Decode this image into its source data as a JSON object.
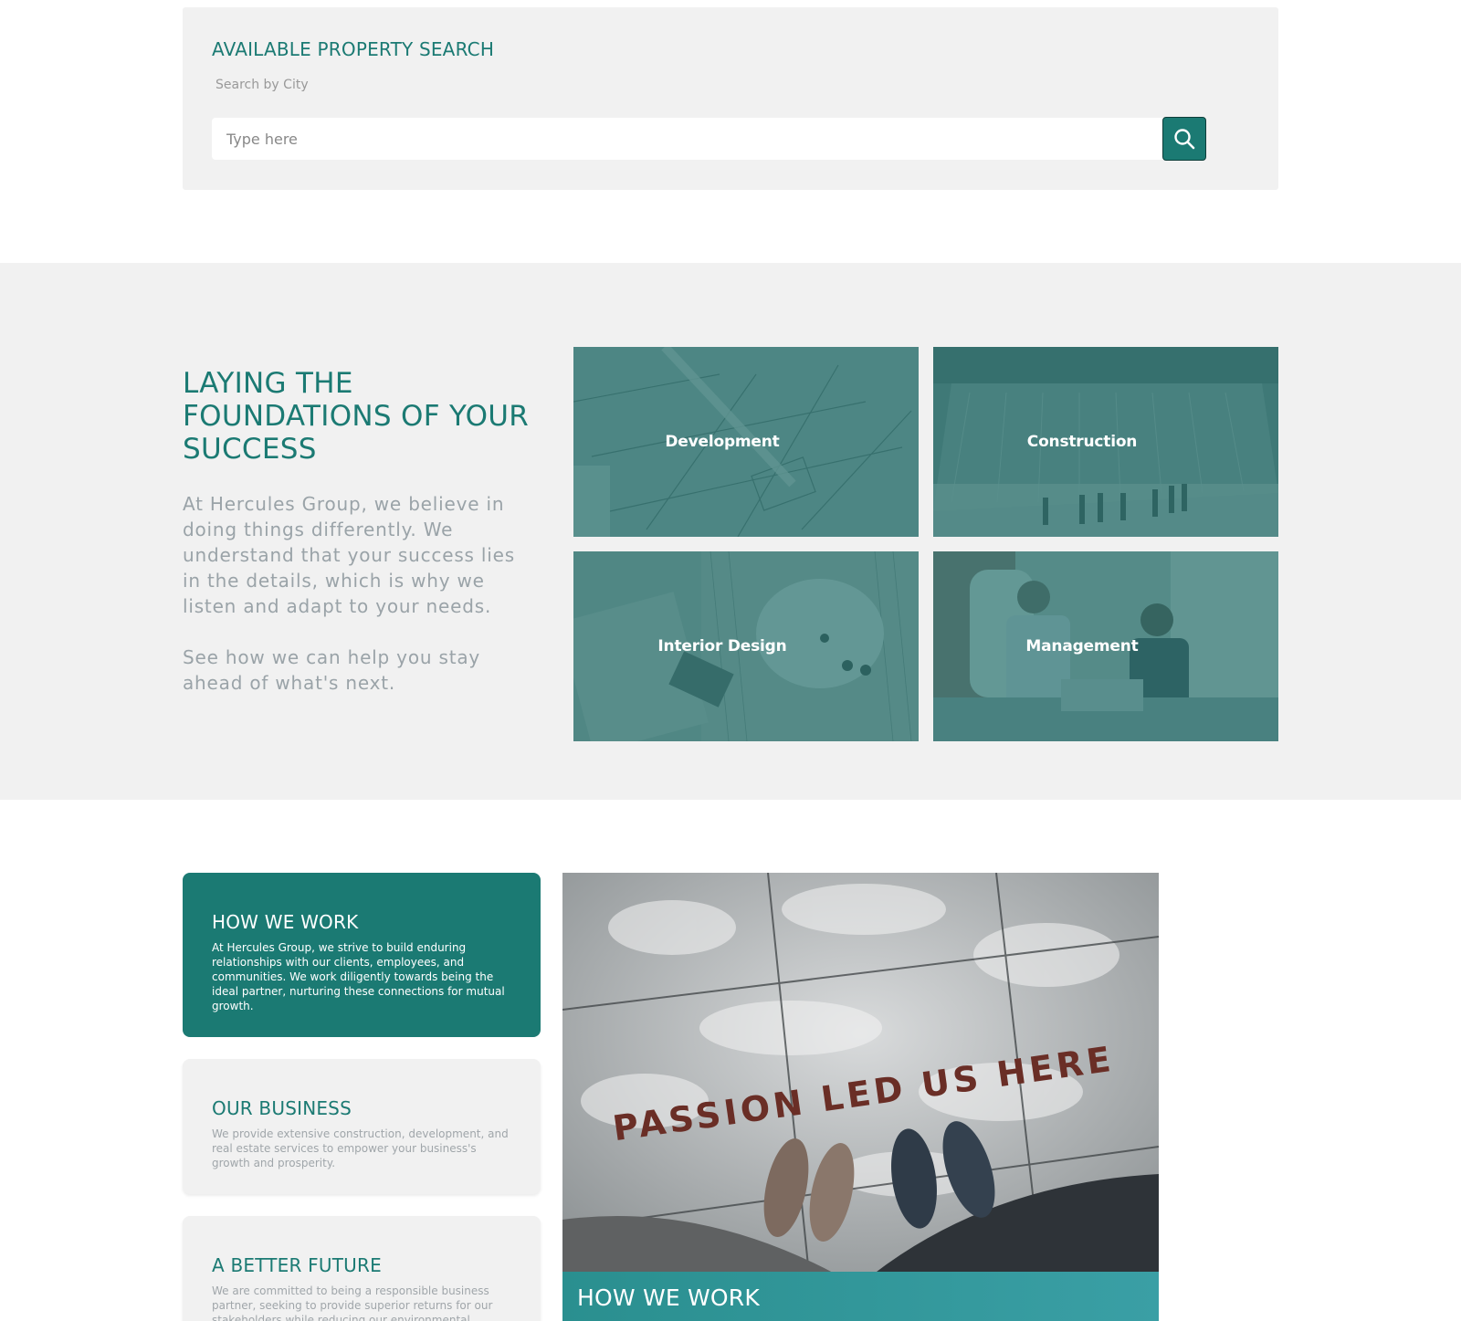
{
  "search": {
    "title": "AVAILABLE PROPERTY SEARCH",
    "label": "Search by City",
    "placeholder": "Type here",
    "button_icon": "search-icon"
  },
  "foundations": {
    "heading": "LAYING THE FOUNDATIONS OF YOUR SUCCESS",
    "paragraph1": "At Hercules Group, we believe in doing things differently. We understand that your success lies in the details, which is why we listen and adapt to your needs.",
    "paragraph2": "See how we can help you stay ahead of what's next.",
    "tiles": [
      {
        "label": "Development"
      },
      {
        "label": "Construction"
      },
      {
        "label": "Interior Design"
      },
      {
        "label": "Management"
      }
    ]
  },
  "how_we_work": {
    "cards": [
      {
        "title": "HOW WE WORK",
        "text": "At Hercules Group, we strive to build enduring relationships with our clients, employees, and communities. We work diligently towards being the ideal partner, nurturing these connections for mutual growth."
      },
      {
        "title": "OUR BUSINESS",
        "text": "We provide extensive construction, development, and real estate services to empower your business's growth and prosperity."
      },
      {
        "title": "A BETTER FUTURE",
        "text": "We are committed to being a responsible business partner, seeking to provide superior returns for our stakeholders while reducing our environmental"
      }
    ],
    "photo_text": "PASSION LED US HERE",
    "photo_caption": "HOW WE WORK"
  },
  "colors": {
    "brand_teal": "#1b7a73",
    "section_gray": "#f1f1f1",
    "muted_text": "#9aa3a8"
  }
}
